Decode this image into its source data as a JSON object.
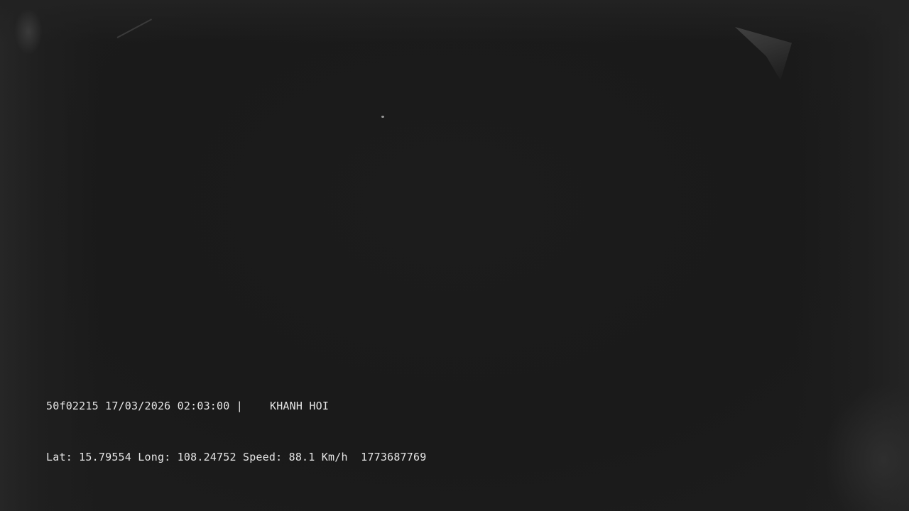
{
  "overlay": {
    "line1": {
      "device_id": "50f02215",
      "date": "17/03/2026",
      "time": "02:03:00",
      "separator": "|",
      "location": "KHANH HOI"
    },
    "line2": {
      "lat_label": "Lat:",
      "lat_value": "15.79554",
      "long_label": "Long:",
      "long_value": "108.24752",
      "speed_label": "Speed:",
      "speed_value": "88.1",
      "speed_unit": "Km/h",
      "timestamp": "1773687769"
    }
  },
  "colors": {
    "background": "#1a1a1a",
    "osd_text": "#e6e6e6"
  }
}
